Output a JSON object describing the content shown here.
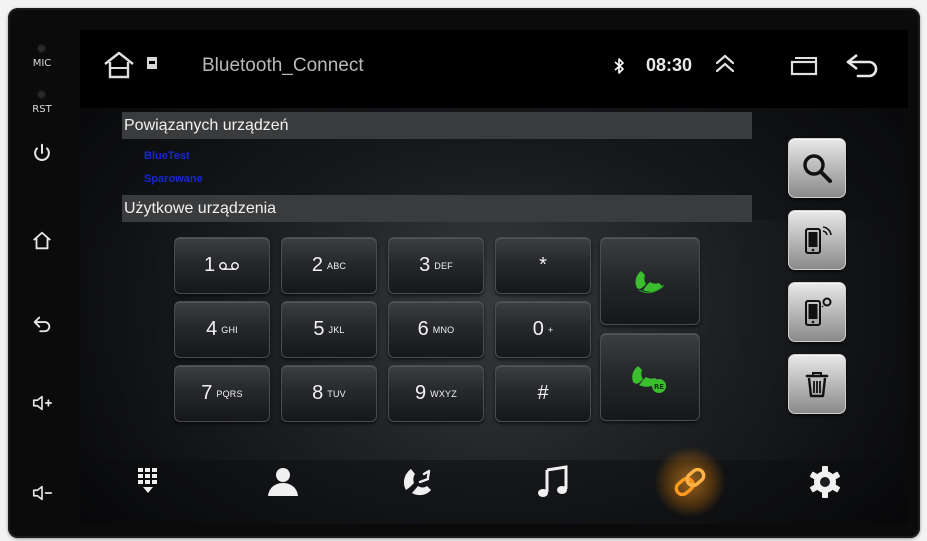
{
  "app": {
    "title": "Bluetooth_Connect"
  },
  "status": {
    "time": "08:30"
  },
  "side_panel": {
    "mic_label": "MIC",
    "rst_label": "RST"
  },
  "sections": {
    "paired_header": "Powiązanych urządzeń",
    "available_header": "Użytkowe urządzenia"
  },
  "paired_devices": [
    {
      "name": "BlueTest"
    },
    {
      "name": "Sparowane"
    }
  ],
  "dialpad": {
    "keys": [
      {
        "digit": "1",
        "sub": ""
      },
      {
        "digit": "2",
        "sub": "ABC"
      },
      {
        "digit": "3",
        "sub": "DEF"
      },
      {
        "digit": "*",
        "sub": ""
      },
      {
        "digit": "4",
        "sub": "GHI"
      },
      {
        "digit": "5",
        "sub": "JKL"
      },
      {
        "digit": "6",
        "sub": "MNO"
      },
      {
        "digit": "0",
        "sub": "+"
      },
      {
        "digit": "7",
        "sub": "PQRS"
      },
      {
        "digit": "8",
        "sub": "TUV"
      },
      {
        "digit": "9",
        "sub": "WXYZ"
      },
      {
        "digit": "#",
        "sub": ""
      }
    ],
    "voicemail_icon": "voicemail-icon",
    "call_icon": "phone-call-icon",
    "redial_icon": "phone-redial-icon"
  },
  "right_actions": [
    {
      "icon": "search-icon"
    },
    {
      "icon": "phone-connect-icon"
    },
    {
      "icon": "phone-disconnect-icon"
    },
    {
      "icon": "trash-icon"
    }
  ],
  "nav": [
    {
      "icon": "dialpad-icon"
    },
    {
      "icon": "contacts-icon"
    },
    {
      "icon": "call-log-icon"
    },
    {
      "icon": "music-icon"
    },
    {
      "icon": "link-icon",
      "active": true
    },
    {
      "icon": "settings-gear-icon"
    }
  ],
  "colors": {
    "accent": "#ff9a1f",
    "call_green": "#3cbf2e",
    "device_text": "#1628d6",
    "header_bg": "#3a3b3d"
  }
}
